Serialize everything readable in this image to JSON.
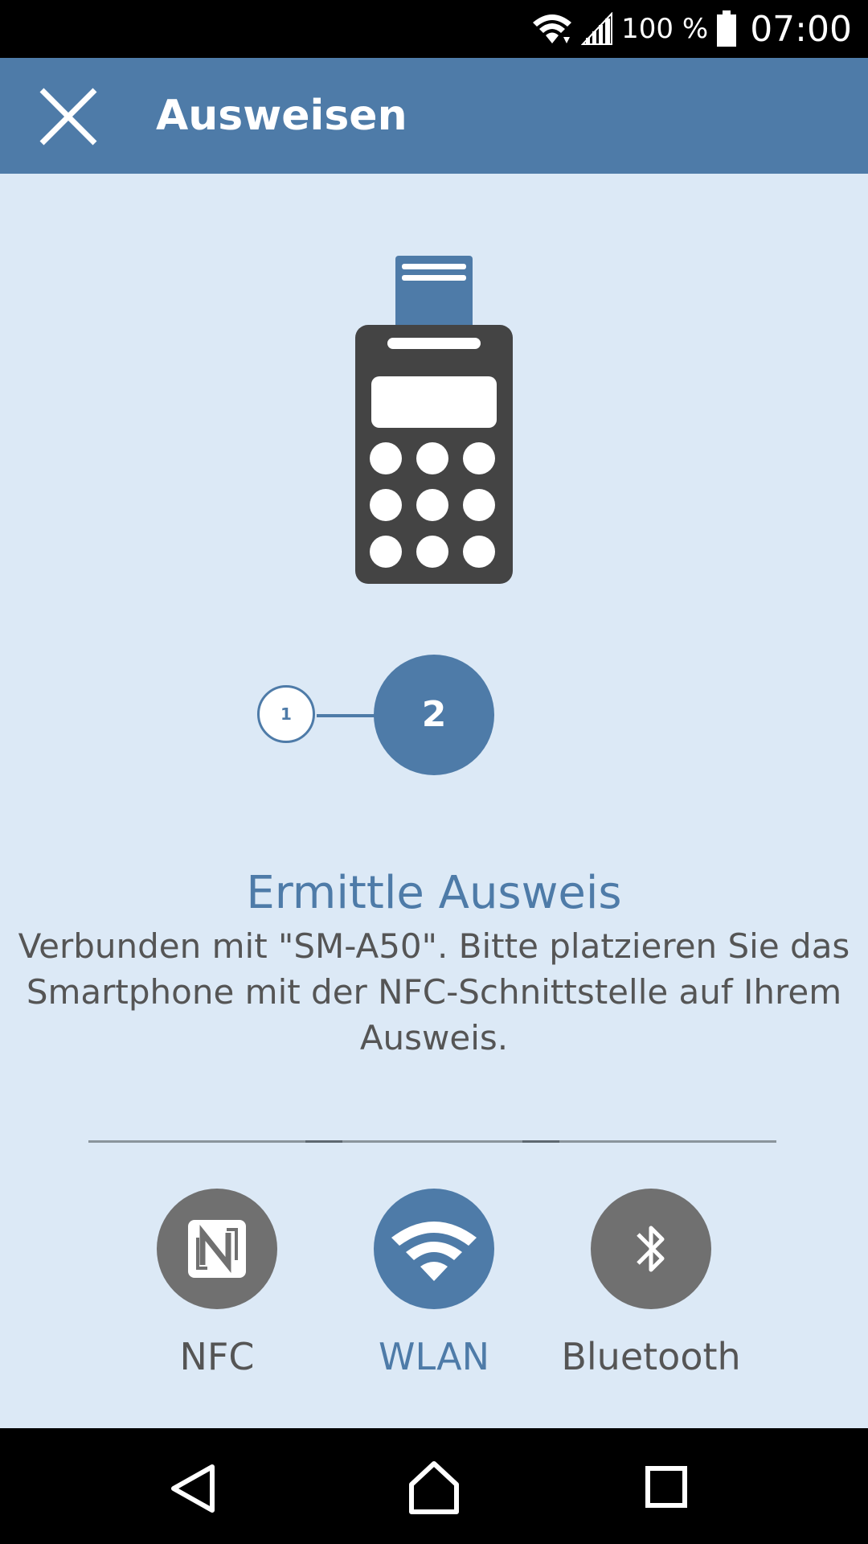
{
  "status_bar": {
    "battery_text": "100 %",
    "time": "07:00",
    "icons": [
      "wifi-icon",
      "cellular-signal-icon",
      "battery-icon"
    ]
  },
  "app_bar": {
    "title": "Ausweisen",
    "close_icon": "close-icon"
  },
  "illustration": {
    "icon": "card-terminal-icon"
  },
  "steps": {
    "items": [
      {
        "label": "1",
        "state": "done"
      },
      {
        "label": "2",
        "state": "active"
      }
    ]
  },
  "status": {
    "headline": "Ermittle Ausweis",
    "message": "Verbunden mit \"SM-A50\". Bitte platzieren Sie das Smartphone mit der NFC-Schnittstelle auf Ihrem Ausweis."
  },
  "connection_options": [
    {
      "label": "NFC",
      "icon": "nfc-icon",
      "active": false
    },
    {
      "label": "WLAN",
      "icon": "wifi-icon",
      "active": true
    },
    {
      "label": "Bluetooth",
      "icon": "bluetooth-icon",
      "active": false
    }
  ],
  "colors": {
    "primary": "#4e7ba8",
    "background": "#dce9f6",
    "inactive": "#707070",
    "text": "#555555"
  },
  "nav_bar": {
    "icons": [
      "back-icon",
      "home-icon",
      "recents-icon"
    ]
  }
}
